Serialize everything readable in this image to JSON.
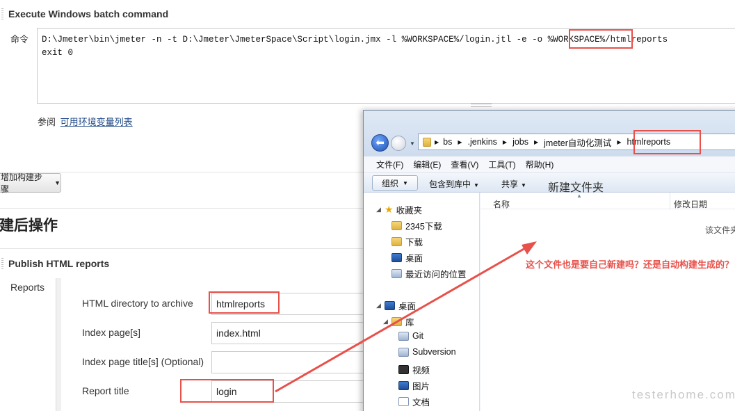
{
  "build_step": {
    "title": "Execute Windows batch command",
    "command_label": "命令",
    "command_line1_prefix": "D:\\Jmeter\\bin\\jmeter -n -t D:\\Jmeter\\JmeterSpace\\Script\\login.jmx -l %WORKSPACE%/login.jtl -e -o %WORKSPACE%/",
    "command_line1_highlight": "htmlreports",
    "command_line2": "exit 0",
    "help_prefix": "参阅",
    "help_link": "可用环境变量列表"
  },
  "add_step_button": "增加构建步骤",
  "post_build_heading": "构建后操作",
  "publish": {
    "title": "Publish HTML reports",
    "reports_label": "Reports",
    "fields": [
      {
        "label": "HTML directory to archive",
        "value": "htmlreports"
      },
      {
        "label": "Index page[s]",
        "value": "index.html"
      },
      {
        "label": "Index page title[s] (Optional)",
        "value": ""
      },
      {
        "label": "Report title",
        "value": "login"
      }
    ]
  },
  "explorer": {
    "breadcrumb": [
      "bs",
      ".jenkins",
      "jobs",
      "jmeter自动化测试",
      "htmlreports"
    ],
    "menu": [
      "文件(F)",
      "编辑(E)",
      "查看(V)",
      "工具(T)",
      "帮助(H)"
    ],
    "toolbar": [
      "组织",
      "包含到库中",
      "共享",
      "新建文件夹"
    ],
    "columns": [
      "名称",
      "修改日期"
    ],
    "empty_text": "该文件夹为空。",
    "favorites_label": "收藏夹",
    "favorites": [
      "2345下载",
      "下载",
      "桌面",
      "最近访问的位置"
    ],
    "desktop_label": "桌面",
    "library_label": "库",
    "libraries": [
      "Git",
      "Subversion",
      "视频",
      "图片",
      "文档"
    ]
  },
  "annotation": "这个文件也是要自己新建吗？还是自动构建生成的？",
  "watermark": "testerhome.com",
  "colors": {
    "annotation_red": "#e8504a",
    "link_blue": "#204a87",
    "explorer_bg": "#f0f3f8"
  }
}
